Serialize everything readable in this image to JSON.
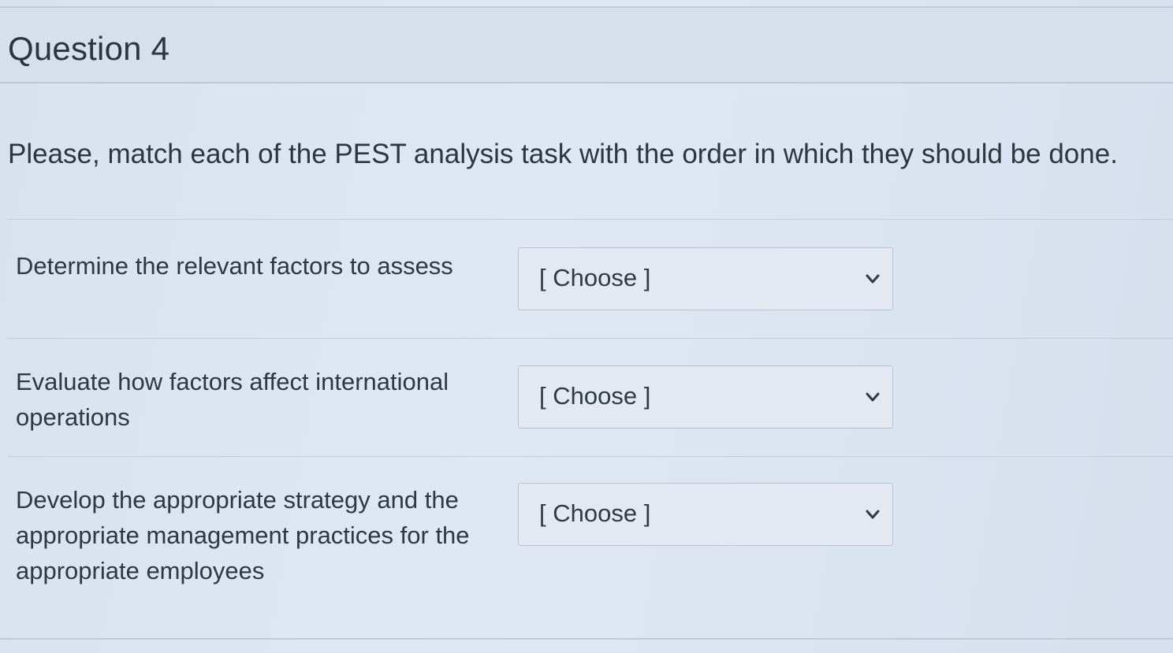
{
  "question": {
    "title": "Question 4",
    "prompt": "Please, match each of the PEST analysis task with the order in which they should be done."
  },
  "matches": [
    {
      "label_lines": [
        "Determine the relevant factors to assess"
      ],
      "select_value": "[ Choose ]"
    },
    {
      "label_lines": [
        "Evaluate how factors affect international",
        "operations"
      ],
      "select_value": "[ Choose ]"
    },
    {
      "label_lines": [
        "Develop the appropriate strategy and the",
        "appropriate management practices for the",
        "appropriate employees"
      ],
      "select_value": "[ Choose ]"
    }
  ],
  "icons": {
    "select_indicator": "chevron-down-icon"
  },
  "colors": {
    "background": "#dbe4f0",
    "text": "#2d3b45",
    "divider": "#c2cbd7",
    "select_border": "#b9c2ce"
  }
}
